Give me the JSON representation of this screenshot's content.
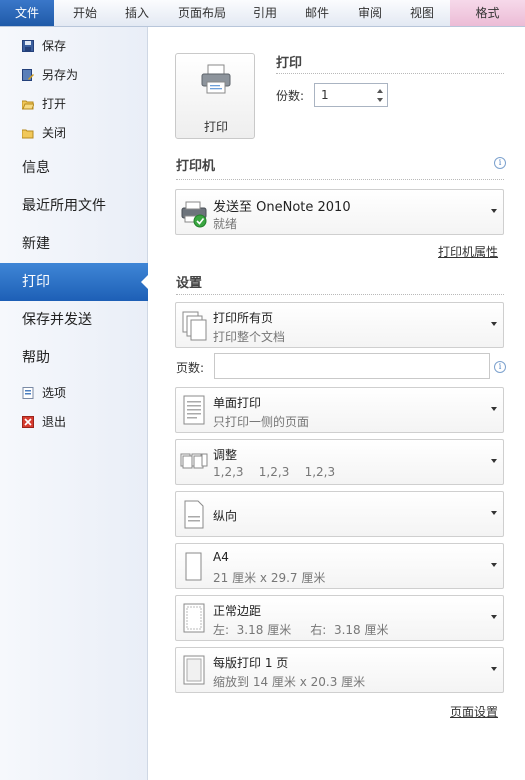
{
  "ribbon": {
    "tabs": [
      "文件",
      "开始",
      "插入",
      "页面布局",
      "引用",
      "邮件",
      "审阅",
      "视图",
      "格式"
    ]
  },
  "nav": {
    "save": "保存",
    "save_as": "另存为",
    "open": "打开",
    "close": "关闭",
    "info": "信息",
    "recent": "最近所用文件",
    "new": "新建",
    "print": "打印",
    "save_send": "保存并发送",
    "help": "帮助",
    "options": "选项",
    "exit": "退出"
  },
  "print_section": {
    "button_label": "打印",
    "title": "打印",
    "copies_label": "份数:",
    "copies_value": "1"
  },
  "printer_section": {
    "title": "打印机",
    "name": "发送至 OneNote 2010",
    "status": "就绪",
    "properties_link": "打印机属性"
  },
  "settings_section": {
    "title": "设置",
    "pages_label": "页数:",
    "pages_value": "",
    "items": [
      {
        "title": "打印所有页",
        "subtitle": "打印整个文档",
        "icon": "pages-icon"
      },
      {
        "title": "单面打印",
        "subtitle": "只打印一侧的页面",
        "icon": "one-sided-icon"
      },
      {
        "title": "调整",
        "subtitle": "1,2,3    1,2,3    1,2,3",
        "icon": "collate-icon"
      },
      {
        "title": "纵向",
        "subtitle": "",
        "icon": "portrait-icon"
      },
      {
        "title": "A4",
        "subtitle": "21 厘米 x 29.7 厘米",
        "icon": "paper-size-icon"
      },
      {
        "title": "正常边距",
        "subtitle": "左:  3.18 厘米     右:  3.18 厘米",
        "icon": "margins-icon"
      },
      {
        "title": "每版打印 1 页",
        "subtitle": "缩放到 14 厘米 x 20.3 厘米",
        "icon": "pages-per-sheet-icon"
      }
    ],
    "page_setup_link": "页面设置"
  },
  "colors": {
    "file_tab": "#2a66b8",
    "active_nav": "#2a6fc4",
    "context_tab": "#efc6dd"
  }
}
